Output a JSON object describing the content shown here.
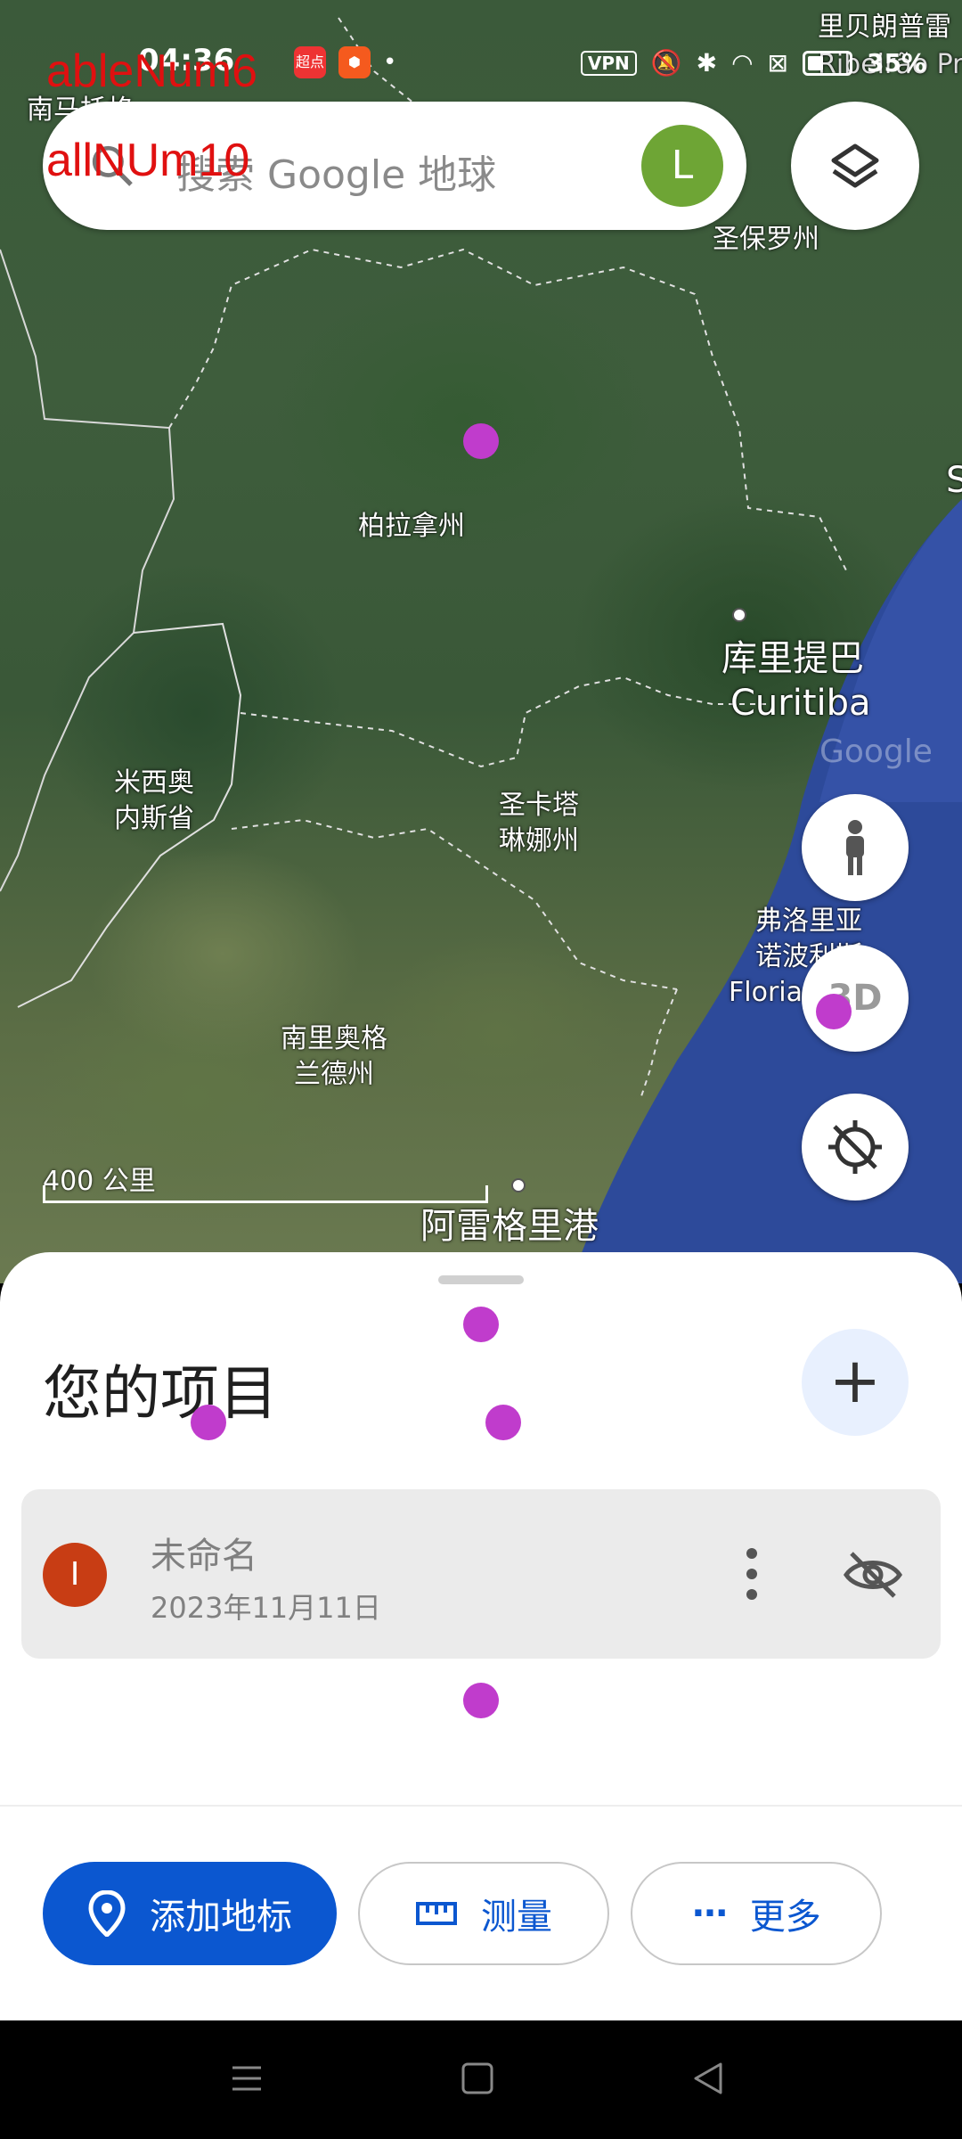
{
  "status_bar": {
    "time": "04:36",
    "vpn": "VPN",
    "battery": "35%",
    "app_badge_1": "超点"
  },
  "overlay": {
    "line1": "ableNum6",
    "line2": "allNUm10"
  },
  "search": {
    "placeholder": "搜索 Google 地球",
    "avatar_letter": "L"
  },
  "map": {
    "labels": {
      "top_right_1": "里贝朗普雷",
      "top_right_2": "Ribeirão Pre",
      "top_left": "南马托格",
      "sao_paulo": "圣保罗州",
      "parana": "柏拉拿州",
      "curitiba_cn": "库里提巴",
      "curitiba_en": "Curitiba",
      "misiones_1": "米西奥",
      "misiones_2": "内斯省",
      "santa_catarina_1": "圣卡塔",
      "santa_catarina_2": "琳娜州",
      "floripa_1": "弗洛里亚",
      "floripa_2": "诺波利斯",
      "floripa_en": "Floria",
      "rio_grande_1": "南里奥格",
      "rio_grande_2": "兰德州",
      "porto_alegre": "阿雷格里港",
      "edge_s": "S",
      "google_watermark": "Google"
    },
    "scale": "400 公里",
    "btn_3d": "3D"
  },
  "sheet": {
    "title": "您的项目",
    "add_label": "+",
    "project": {
      "avatar": "I",
      "name": "未命名",
      "date": "2023年11月11日"
    }
  },
  "actions": {
    "add_placemark": "添加地标",
    "measure": "测量",
    "more": "更多"
  },
  "colors": {
    "primary": "#0b57d0",
    "avatar_green": "#6ea535",
    "project_avatar": "#c83d14",
    "marker": "#c03ccc"
  }
}
